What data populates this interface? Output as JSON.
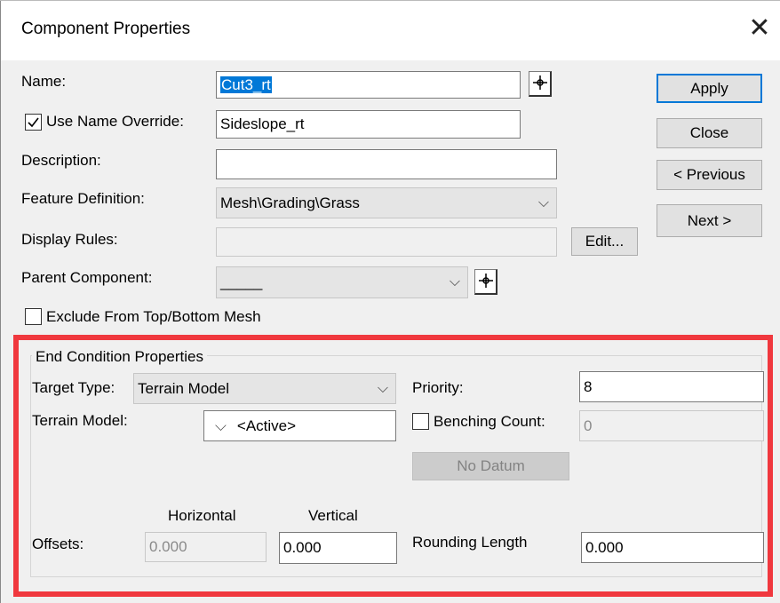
{
  "window": {
    "title": "Component Properties",
    "close_glyph": "✕"
  },
  "fields": {
    "name": {
      "label": "Name:",
      "value": "Cut3_rt"
    },
    "name_override": {
      "label": "Use Name Override:",
      "value": "Sideslope_rt",
      "checked": true
    },
    "description": {
      "label": "Description:",
      "value": ""
    },
    "feature_definition": {
      "label": "Feature Definition:",
      "value": "Mesh\\Grading\\Grass"
    },
    "display_rules": {
      "label": "Display Rules:",
      "value": "",
      "edit_label": "Edit..."
    },
    "parent_component": {
      "label": "Parent Component:",
      "value": "_____"
    },
    "exclude_mesh": {
      "label": "Exclude From Top/Bottom Mesh",
      "checked": false
    }
  },
  "side_buttons": {
    "apply": "Apply",
    "close": "Close",
    "previous": "< Previous",
    "next": "Next >"
  },
  "end_condition": {
    "group_title": "End Condition Properties",
    "target_type": {
      "label": "Target Type:",
      "value": "Terrain Model"
    },
    "terrain_model": {
      "label": "Terrain Model:",
      "value": "<Active>"
    },
    "priority": {
      "label": "Priority:",
      "value": "8"
    },
    "benching_count": {
      "label": "Benching Count:",
      "value": "0",
      "checked": false
    },
    "no_datum": "No Datum",
    "offsets": {
      "label": "Offsets:",
      "horizontal_header": "Horizontal",
      "vertical_header": "Vertical",
      "horizontal": "0.000",
      "vertical": "0.000"
    },
    "rounding_length": {
      "label": "Rounding Length",
      "value": "0.000"
    }
  },
  "colors": {
    "highlight_border": "#f0383e",
    "selection": "#0078d7",
    "dialog_bg": "#f0f0f0"
  }
}
